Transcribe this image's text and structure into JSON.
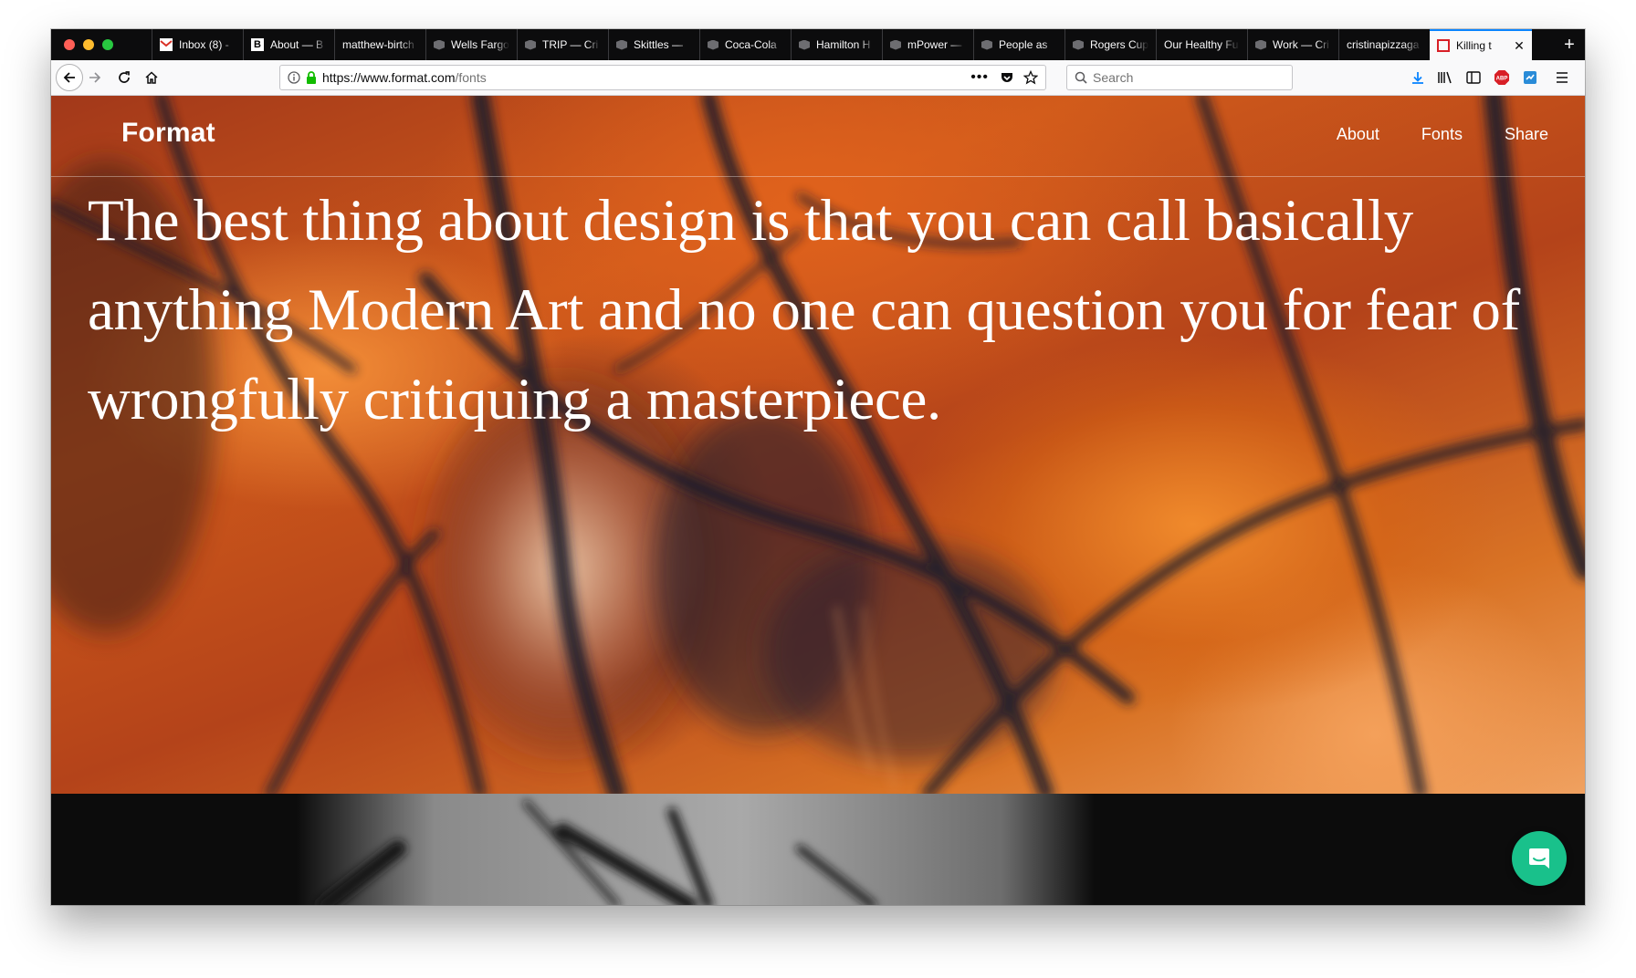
{
  "browser": {
    "tabs": [
      {
        "label": "Inbox (8) -",
        "icon": "gmail-icon",
        "active": false
      },
      {
        "label": "About — B",
        "icon": "b-icon",
        "active": false
      },
      {
        "label": "matthew-birtch",
        "icon": "",
        "active": false
      },
      {
        "label": "Wells Fargo",
        "icon": "cube-icon",
        "active": false
      },
      {
        "label": "TRIP — Cri",
        "icon": "cube-icon",
        "active": false
      },
      {
        "label": "Skittles —",
        "icon": "cube-icon",
        "active": false
      },
      {
        "label": "Coca-Cola",
        "icon": "cube-icon",
        "active": false
      },
      {
        "label": "Hamilton H",
        "icon": "cube-icon",
        "active": false
      },
      {
        "label": "mPower —",
        "icon": "cube-icon",
        "active": false
      },
      {
        "label": "People as",
        "icon": "cube-icon",
        "active": false
      },
      {
        "label": "Rogers Cup",
        "icon": "cube-icon",
        "active": false
      },
      {
        "label": "Our Healthy Fu",
        "icon": "",
        "active": false
      },
      {
        "label": "Work — Cri",
        "icon": "cube-icon",
        "active": false
      },
      {
        "label": "cristinapizzaga",
        "icon": "",
        "active": false
      },
      {
        "label": "Killing t",
        "icon": "format-icon",
        "active": true
      }
    ],
    "url_host": "https://www.format.com",
    "url_path": "/fonts",
    "search_placeholder": "Search",
    "colors": {
      "tab_strip": "#0c0c0d",
      "toolbar": "#f9f9fa",
      "accent": "#0a84ff"
    }
  },
  "site": {
    "logo": "Format",
    "nav": [
      "About",
      "Fonts",
      "Share"
    ],
    "quote": "The best thing about design is that you can call basically anything Modern Art and no one can question you for fear of wrongfully critiquing a masterpiece.",
    "chat_color": "#19c18b"
  }
}
